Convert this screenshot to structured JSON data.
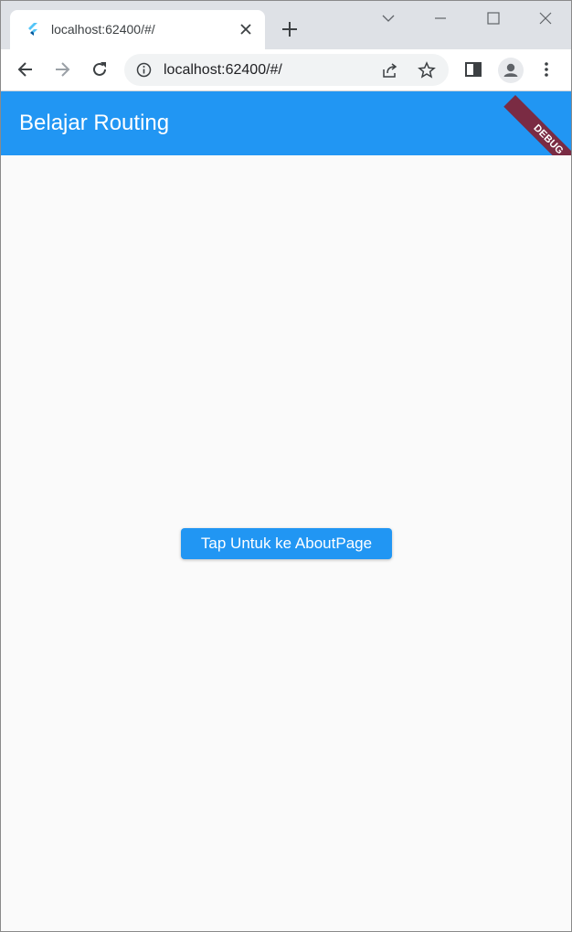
{
  "browser": {
    "tab": {
      "title": "localhost:62400/#/",
      "favicon": "flutter-icon"
    },
    "address_bar": {
      "url": "localhost:62400/#/"
    },
    "icons": [
      "back-icon",
      "forward-icon",
      "reload-icon",
      "info-icon",
      "share-icon",
      "star-icon",
      "side-panel-icon",
      "profile-icon",
      "menu-icon",
      "tab-search-icon",
      "minimize-icon",
      "maximize-icon",
      "close-window-icon",
      "new-tab-icon"
    ]
  },
  "app": {
    "appbar": {
      "title": "Belajar Routing",
      "color": "#2196f3"
    },
    "debug_banner": "DEBUG",
    "main_button": {
      "label": "Tap Untuk ke AboutPage"
    }
  }
}
